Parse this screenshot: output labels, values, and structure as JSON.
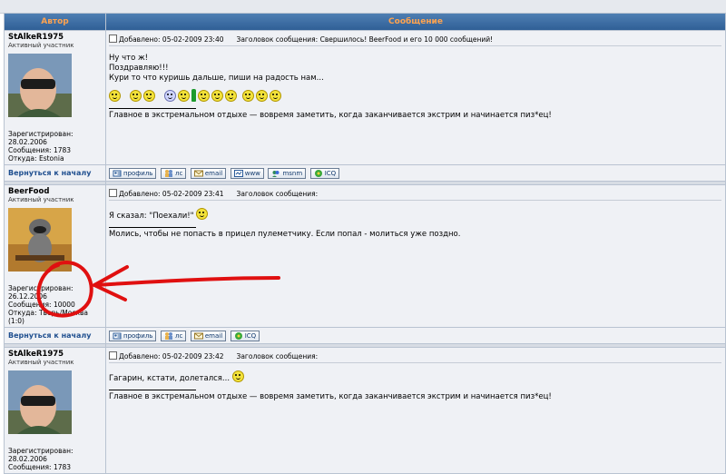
{
  "header": {
    "author_col": "Автор",
    "message_col": "Сообщение"
  },
  "labels": {
    "posted": "Добавлено:",
    "subject": "Заголовок сообщения:",
    "registered": "Зарегистрирован:",
    "messages": "Сообщения:",
    "from": "Откуда:",
    "back_to_top": "Вернуться к началу"
  },
  "buttons": {
    "profile": "профиль",
    "pm": "лс",
    "email": "email",
    "www": "www",
    "msnm": "msnm",
    "icq": "ICQ"
  },
  "posts": [
    {
      "author": "StAlkeR1975",
      "rank": "Активный участник",
      "registered": "28.02.2006",
      "messages": "1783",
      "from": "Estonia",
      "date": "05-02-2009 23:40",
      "subject": "Свершилось! BeerFood и его 10 000 сообщений!",
      "lines": [
        "Ну что ж!",
        "Поздравляю!!!",
        "Кури то что куришь дальше, пиши на радость нам..."
      ],
      "signature": "Главное в экстремальном отдыхе — вовремя заметить, когда заканчивается экстрим и начинается пиз*ец!"
    },
    {
      "author": "BeerFood",
      "rank": "Активный участник",
      "registered": "26.12.2006",
      "messages": "10000",
      "from": "Тверь/Москва",
      "from2": "(1:0)",
      "date": "05-02-2009 23:41",
      "subject": "",
      "lines": [
        "Я сказал: \"Поехали!\""
      ],
      "signature": "Молись, чтобы не попасть в прицел пулеметчику. Если попал - молиться уже поздно."
    },
    {
      "author": "StAlkeR1975",
      "rank": "Активный участник",
      "registered": "28.02.2006",
      "messages": "1783",
      "date": "05-02-2009 23:42",
      "subject": "",
      "lines": [
        "Гагарин, кстати, долетался..."
      ],
      "signature": "Главное в экстремальном отдыхе — вовремя заметить, когда заканчивается экстрим и начинается пиз*ец!"
    }
  ],
  "colors": {
    "header_bg": "#3a6aa3",
    "header_text": "#ffa34f",
    "cell_bg": "#eff1f5",
    "annotation": "#e01010"
  }
}
